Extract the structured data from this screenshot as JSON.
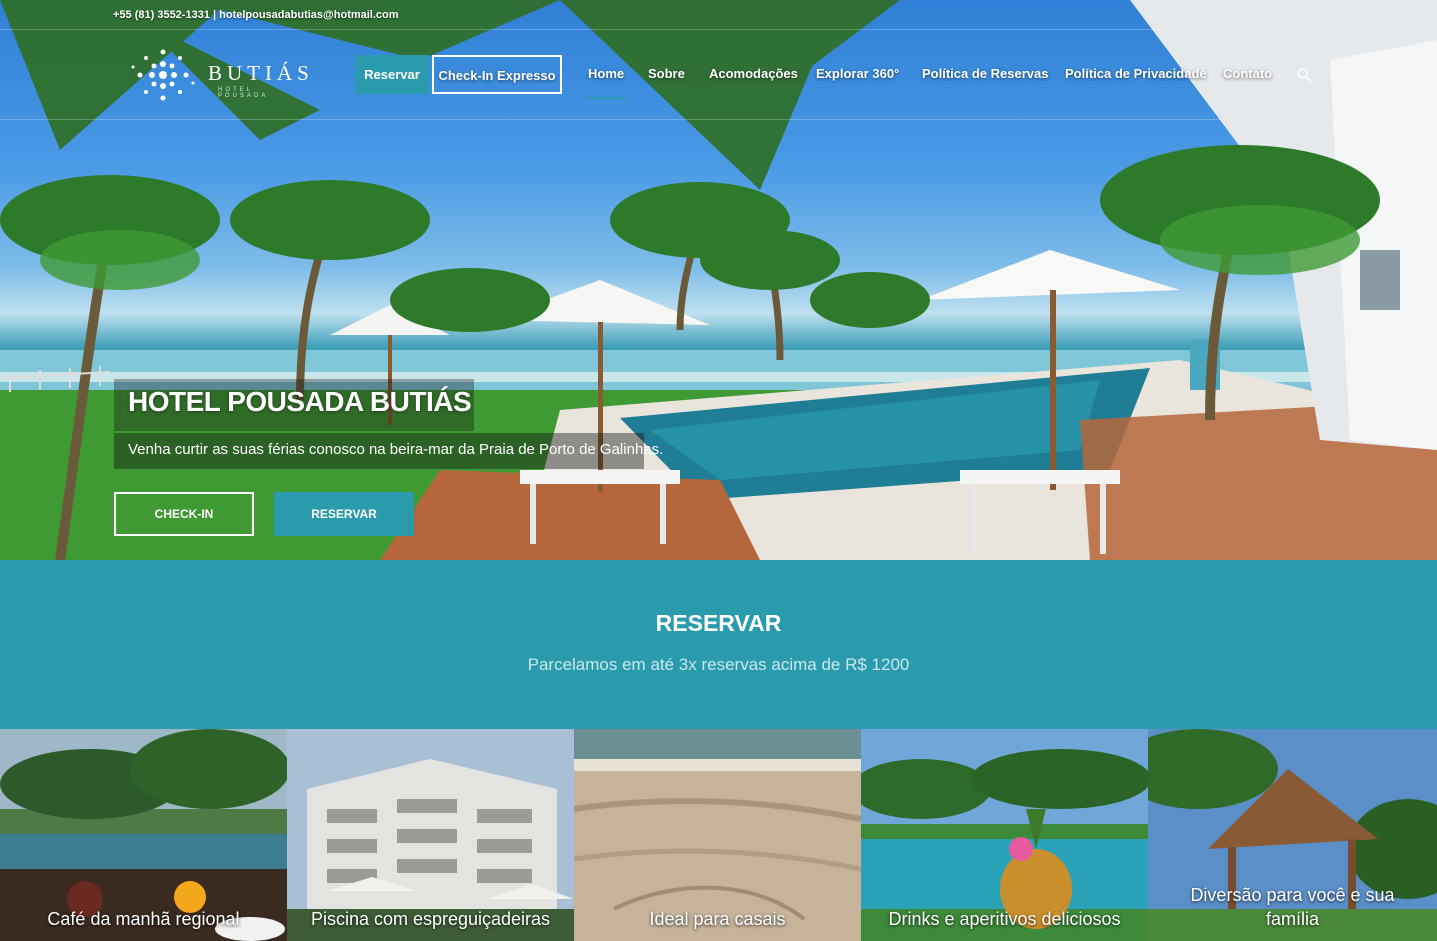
{
  "topbar": {
    "contact": "+55 (81) 3552-1331 | hotelpousadabutias@hotmail.com"
  },
  "logo": {
    "name": "BUTIÁS",
    "tagline": "HOTEL POUSADA"
  },
  "nav": {
    "reservar_button": "Reservar",
    "checkin_button": "Check-In Expresso",
    "items": [
      {
        "label": "Home",
        "active": true
      },
      {
        "label": "Sobre"
      },
      {
        "label": "Acomodações"
      },
      {
        "label": "Explorar 360°"
      },
      {
        "label": "Política de Reservas"
      },
      {
        "label": "Política de Privacidade"
      },
      {
        "label": "Contato"
      }
    ]
  },
  "hero": {
    "title": "HOTEL POUSADA BUTIÁS",
    "subtitle": "Venha curtir as suas férias conosco na beira-mar da Praia de Porto de Galinhas.",
    "checkin_button": "CHECK-IN",
    "reservar_button": "RESERVAR"
  },
  "band": {
    "title": "RESERVAR",
    "subtitle": "Parcelamos em até 3x reservas acima de R$ 1200"
  },
  "tiles": [
    {
      "caption": "Café da manhã regional"
    },
    {
      "caption": "Piscina com espreguiçadeiras"
    },
    {
      "caption": "Ideal para casais"
    },
    {
      "caption": "Drinks e aperitivos deliciosos"
    },
    {
      "caption": "Diversão para você e sua família"
    }
  ],
  "colors": {
    "accent": "#2a9aad",
    "band_subtitle": "#c9e9ee"
  }
}
